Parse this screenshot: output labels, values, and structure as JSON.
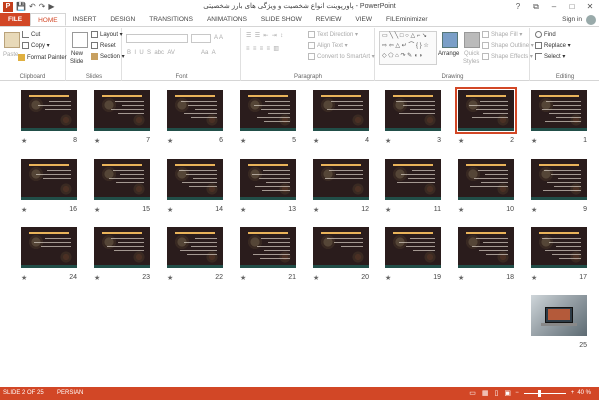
{
  "app": {
    "title": "پاورپوینت انواع شخصیت و ویژگی های بارز شخصیتی - PowerPoint",
    "logo": "P",
    "qat_icons": [
      "save-icon",
      "undo-icon",
      "redo-icon",
      "slideshow-icon"
    ],
    "window_controls": [
      "?",
      "⧉",
      "–",
      "□",
      "✕"
    ],
    "sign_in": "Sign in"
  },
  "tabs": [
    "FILE",
    "HOME",
    "INSERT",
    "DESIGN",
    "TRANSITIONS",
    "ANIMATIONS",
    "SLIDE SHOW",
    "REVIEW",
    "VIEW",
    "FILEminimizer"
  ],
  "active_tab": "HOME",
  "ribbon": {
    "clipboard": {
      "label": "Clipboard",
      "paste": "Paste",
      "cut": "Cut",
      "copy": "Copy",
      "format_painter": "Format Painter"
    },
    "slides": {
      "label": "Slides",
      "new_slide_1": "New",
      "new_slide_2": "Slide",
      "layout": "Layout",
      "reset": "Reset",
      "section": "Section"
    },
    "font": {
      "label": "Font",
      "font_name": "",
      "font_size": ""
    },
    "paragraph": {
      "label": "Paragraph",
      "text_direction": "Text Direction",
      "align_text": "Align Text",
      "convert_smartart": "Convert to SmartArt"
    },
    "drawing": {
      "label": "Drawing",
      "arrange": "Arrange",
      "quick_styles_1": "Quick",
      "quick_styles_2": "Styles",
      "shape_fill": "Shape Fill",
      "shape_outline": "Shape Outline",
      "shape_effects": "Shape Effects"
    },
    "editing": {
      "label": "Editing",
      "find": "Find",
      "replace": "Replace",
      "select": "Select"
    }
  },
  "slides": [
    {
      "n": "8"
    },
    {
      "n": "7"
    },
    {
      "n": "6"
    },
    {
      "n": "5"
    },
    {
      "n": "4"
    },
    {
      "n": "3"
    },
    {
      "n": "2"
    },
    {
      "n": "1"
    },
    {
      "n": "16"
    },
    {
      "n": "15"
    },
    {
      "n": "14"
    },
    {
      "n": "13"
    },
    {
      "n": "12"
    },
    {
      "n": "11"
    },
    {
      "n": "10"
    },
    {
      "n": "9"
    },
    {
      "n": "24"
    },
    {
      "n": "23"
    },
    {
      "n": "22"
    },
    {
      "n": "21"
    },
    {
      "n": "20"
    },
    {
      "n": "19"
    },
    {
      "n": "18"
    },
    {
      "n": "17"
    },
    {
      "n": "25"
    }
  ],
  "selected_slide": "2",
  "star": "★",
  "status": {
    "slide_of": "SLIDE 2 OF 25",
    "language": "PERSIAN",
    "zoom": "40 %",
    "zoom_minus": "−",
    "zoom_plus": "+"
  },
  "colors": {
    "accent": "#d24726",
    "slide_bg": "#2a1c1c"
  }
}
